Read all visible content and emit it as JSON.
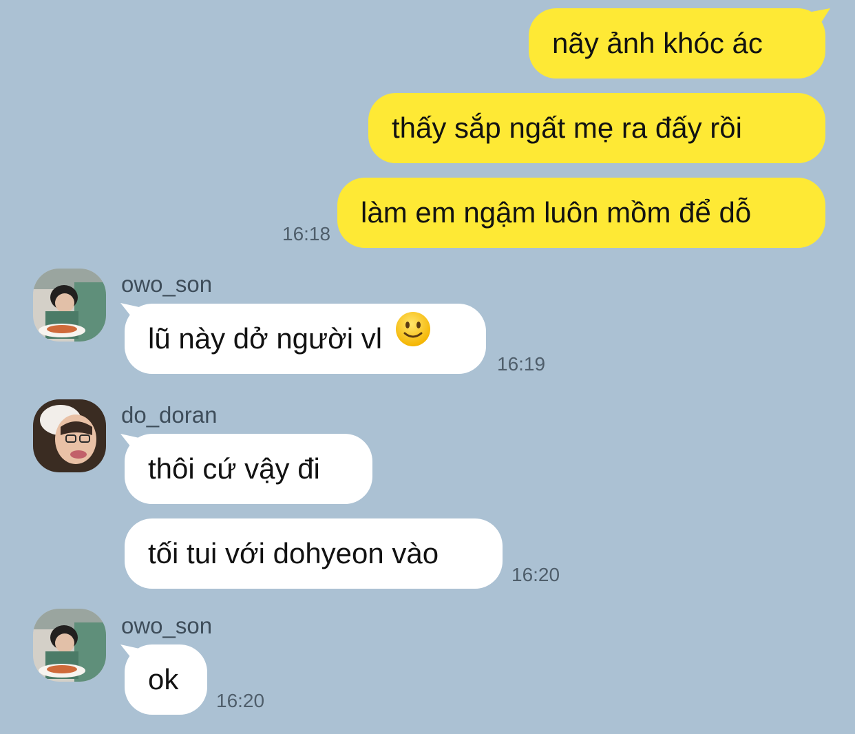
{
  "messages": [
    {
      "direction": "outgoing",
      "text": "nãy ảnh khóc ác"
    },
    {
      "direction": "outgoing",
      "text": "thấy sắp ngất mẹ ra đấy rồi"
    },
    {
      "direction": "outgoing",
      "text": "làm em ngậm luôn mồm để dỗ",
      "time": "16:18"
    },
    {
      "direction": "incoming",
      "sender": "owo_son",
      "text": "lũ này dở người vl",
      "emoji": "slightly-smiling-face",
      "time": "16:19"
    },
    {
      "direction": "incoming",
      "sender": "do_doran",
      "text": "thôi cứ vậy đi"
    },
    {
      "direction": "incoming",
      "sender": "do_doran",
      "text": "tối tui với dohyeon vào",
      "time": "16:20"
    },
    {
      "direction": "incoming",
      "sender": "owo_son",
      "text": "ok",
      "time": "16:20"
    }
  ],
  "colors": {
    "background": "#abc1d3",
    "outgoing_bubble": "#fee935",
    "incoming_bubble": "#ffffff",
    "timestamp": "#4f5e6b",
    "sender_name": "#3e4d5a"
  }
}
